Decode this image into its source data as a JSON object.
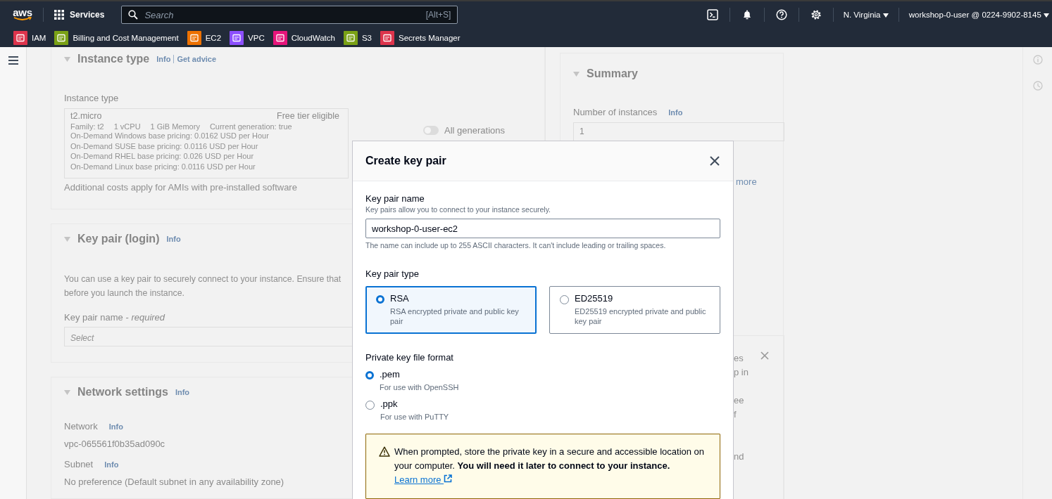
{
  "top_nav": {
    "logo": "aws",
    "services_label": "Services",
    "search": {
      "placeholder": "Search",
      "shortcut": "[Alt+S]"
    },
    "region": "N. Virginia",
    "account": "workshop-0-user @ 0224-9902-8145"
  },
  "favorites": [
    {
      "label": "IAM",
      "color": "#dd344c"
    },
    {
      "label": "Billing and Cost Management",
      "color": "#7aa116"
    },
    {
      "label": "EC2",
      "color": "#ed7100"
    },
    {
      "label": "VPC",
      "color": "#8c4fff"
    },
    {
      "label": "CloudWatch",
      "color": "#e7157b"
    },
    {
      "label": "S3",
      "color": "#7aa116"
    },
    {
      "label": "Secrets Manager",
      "color": "#dd344c"
    }
  ],
  "instance_type_section": {
    "title": "Instance type",
    "info": "Info",
    "advice": "Get advice",
    "field_label": "Instance type",
    "selected_type": {
      "name": "t2.micro",
      "badge": "Free tier eligible",
      "specs": [
        "Family: t2",
        "1 vCPU",
        "1 GiB Memory",
        "Current generation: true"
      ],
      "pricing": [
        "On-Demand Windows base pricing: 0.0162 USD per Hour",
        "On-Demand SUSE base pricing: 0.0116 USD per Hour",
        "On-Demand RHEL base pricing: 0.026 USD per Hour",
        "On-Demand Linux base pricing: 0.0116 USD per Hour"
      ]
    },
    "all_generations": {
      "label": "All generations",
      "on": false
    },
    "note": "Additional costs apply for AMIs with pre-installed software"
  },
  "key_pair_section": {
    "title": "Key pair (login)",
    "info": "Info",
    "description_lines": [
      "You can use a key pair to securely connect to your instance. Ensure that",
      "before you launch the instance."
    ],
    "field_label": "Key pair name - *required*",
    "placeholder": "Select"
  },
  "network_section": {
    "title": "Network settings",
    "info": "Info",
    "fields": [
      {
        "label": "Network",
        "info": "Info",
        "value": "vpc-065561f0b35ad090c"
      },
      {
        "label": "Subnet",
        "info": "Info",
        "value": "No preference (Default subnet in any availability zone)"
      }
    ]
  },
  "summary": {
    "title": "Summary",
    "instances_label": "Number of instances",
    "info": "Info",
    "instances_value": "1",
    "link_fragment": "more",
    "notice_fragments": [
      "es",
      "p in",
      "ee",
      "f",
      "nd"
    ]
  },
  "modal": {
    "title": "Create key pair",
    "name_field": {
      "label": "Key pair name",
      "description": "Key pairs allow you to connect to your instance securely.",
      "value": "workshop-0-user-ec2",
      "constraint": "The name can include up to 255 ASCII characters. It can't include leading or trailing spaces."
    },
    "type_label": "Key pair type",
    "types": [
      {
        "label": "RSA",
        "description": "RSA encrypted private and public key pair",
        "selected": true
      },
      {
        "label": "ED25519",
        "description": "ED25519 encrypted private and public key pair",
        "selected": false
      }
    ],
    "format_label": "Private key file format",
    "formats": [
      {
        "label": ".pem",
        "description": "For use with OpenSSH",
        "selected": true
      },
      {
        "label": ".ppk",
        "description": "For use with PuTTY",
        "selected": false
      }
    ],
    "alert": {
      "text": "When prompted, store the private key in a secure and accessible location on your computer. **You will need it later to connect to your instance.**",
      "link": "Learn more"
    }
  }
}
